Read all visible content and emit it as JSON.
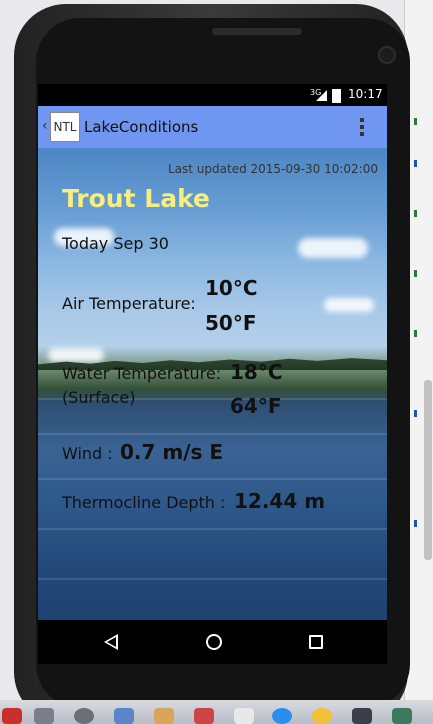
{
  "status_bar": {
    "network": "3G",
    "time": "10:17"
  },
  "action_bar": {
    "logo_text": "NTL",
    "app_title": "LakeConditions"
  },
  "conditions": {
    "last_updated": "Last updated 2015-09-30 10:02:00",
    "lake_name": "Trout Lake",
    "date": "Today Sep  30",
    "air_label": "Air Temperature:",
    "air_c": "10°C",
    "air_f": "50°F",
    "water_label": "Water Temperature:",
    "water_sublabel": "(Surface)",
    "water_c": "18°C",
    "water_f": "64°F",
    "wind_label": "Wind :",
    "wind_value": "0.7 m/s E",
    "thermocline_label": "Thermocline Depth :",
    "thermocline_value": "12.44 m"
  },
  "nav_bar": {
    "icons": [
      "back-icon",
      "home-icon",
      "recent-apps-icon"
    ]
  },
  "colors": {
    "action_bar": "#6f96f0",
    "lake_name": "#f6ee7d",
    "status_bar": "#000000",
    "nav_bar": "#000000"
  }
}
